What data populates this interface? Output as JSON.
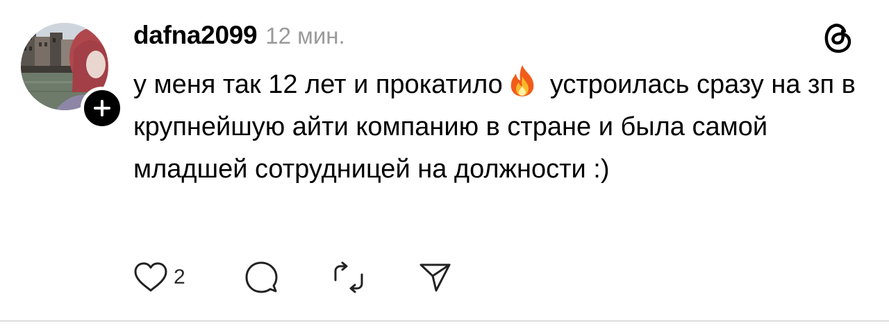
{
  "post": {
    "username": "dafna2099",
    "timestamp": "12 мин.",
    "text_part1": "у меня так 12 лет и прокатило",
    "text_part2": "устроилась сразу на зп в крупнейшую айти компанию в стране и была самой младшей сотрудницей на должности :)",
    "emoji": "fire-emoji"
  },
  "actions": {
    "like_count": "2",
    "like_icon": "heart-icon",
    "reply_icon": "comment-icon",
    "repost_icon": "repost-icon",
    "share_icon": "send-icon"
  },
  "icons": {
    "app_logo": "threads-logo-icon",
    "follow": "plus-icon"
  },
  "colors": {
    "text": "#000000",
    "muted": "#9a9a9a",
    "divider": "#dcdcdc",
    "badge": "#000000"
  }
}
